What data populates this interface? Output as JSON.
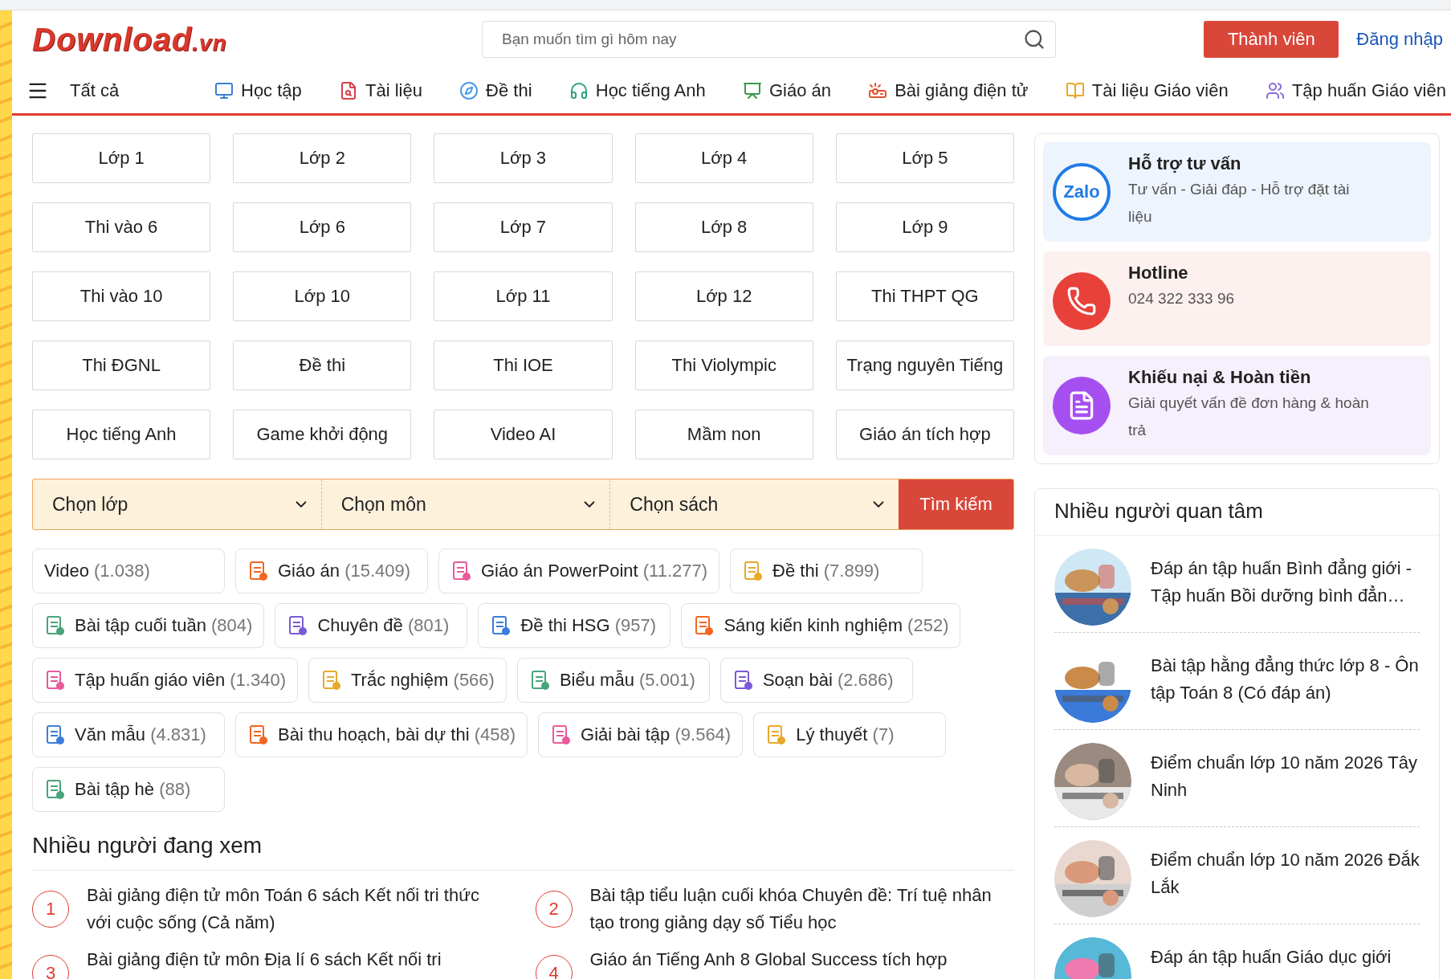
{
  "logo": {
    "name": "Download",
    "suffix": ".vn"
  },
  "search": {
    "placeholder": "Bạn muốn tìm gì hôm nay"
  },
  "header_buttons": [
    {
      "label": "Thành viên",
      "kind": "primary"
    },
    {
      "label": "Đăng nhập",
      "kind": "link"
    }
  ],
  "nav": {
    "all": "Tất cả",
    "items": [
      "Học tập",
      "Tài liệu",
      "Đề thi",
      "Học tiếng Anh",
      "Giáo án",
      "Bài giảng điện tử",
      "Tài liệu Giáo viên",
      "Tập huấn Giáo viên"
    ]
  },
  "classes": [
    "Lớp 1",
    "Lớp 2",
    "Lớp 3",
    "Lớp 4",
    "Lớp 5",
    "Thi vào 6",
    "Lớp 6",
    "Lớp 7",
    "Lớp 8",
    "Lớp 9",
    "Thi vào 10",
    "Lớp 10",
    "Lớp 11",
    "Lớp 12",
    "Thi THPT QG",
    "Thi ĐGNL",
    "Đề thi",
    "Thi IOE",
    "Thi Violympic",
    "Trạng nguyên Tiếng",
    "Học tiếng Anh",
    "Game khởi động",
    "Video AI",
    "Mầm non",
    "Giáo án tích hợp"
  ],
  "filter": {
    "selects": [
      "Chọn lớp",
      "Chọn môn",
      "Chọn sách"
    ],
    "button": "Tìm kiếm"
  },
  "tags": [
    {
      "label": "Video",
      "count": "(1.038)",
      "icon": false
    },
    {
      "label": "Giáo án",
      "count": "(15.409)",
      "icon": true
    },
    {
      "label": "Giáo án PowerPoint",
      "count": "(11.277)",
      "icon": true
    },
    {
      "label": "Đề thi",
      "count": "(7.899)",
      "icon": true
    },
    {
      "label": "Bài tập cuối tuần",
      "count": "(804)",
      "icon": true
    },
    {
      "label": "Chuyên đề",
      "count": "(801)",
      "icon": true
    },
    {
      "label": "Đề thi HSG",
      "count": "(957)",
      "icon": true
    },
    {
      "label": "Sáng kiến kinh nghiệm",
      "count": "(252)",
      "icon": true
    },
    {
      "label": "Tập huấn giáo viên",
      "count": "(1.340)",
      "icon": true
    },
    {
      "label": "Trắc nghiệm",
      "count": "(566)",
      "icon": true
    },
    {
      "label": "Biểu mẫu",
      "count": "(5.001)",
      "icon": true
    },
    {
      "label": "Soạn bài",
      "count": "(2.686)",
      "icon": true
    },
    {
      "label": "Văn mẫu",
      "count": "(4.831)",
      "icon": true
    },
    {
      "label": "Bài thu hoạch, bài dự thi",
      "count": "(458)",
      "icon": true
    },
    {
      "label": "Giải bài tập",
      "count": "(9.564)",
      "icon": true
    },
    {
      "label": "Lý thuyết",
      "count": "(7)",
      "icon": true
    },
    {
      "label": "Bài tập hè",
      "count": "(88)",
      "icon": true
    }
  ],
  "watching": {
    "title": "Nhiều người đang xem",
    "items": [
      {
        "number": "1",
        "title": "Bài giảng điện tử môn Toán 6 sách Kết nối tri thức với cuộc sống (Cả năm)"
      },
      {
        "number": "2",
        "title": "Bài tập tiểu luận cuối khóa Chuyên đề: Trí tuệ nhân tạo trong giảng dạy số Tiểu học"
      },
      {
        "number": "3",
        "title": "Bài giảng điện tử môn Địa lí 6 sách Kết nối tri"
      },
      {
        "number": "4",
        "title": "Giáo án Tiếng Anh 8 Global Success tích hợp"
      }
    ]
  },
  "support": [
    {
      "kind": "zalo",
      "color": "#eef4fd",
      "logo": "Zalo",
      "title": "Hỗ trợ tư vấn",
      "subtitle": "Tư vấn - Giải đáp - Hỗ trợ đặt tài liệu"
    },
    {
      "kind": "phone",
      "color": "#fdf1ef",
      "title": "Hotline",
      "subtitle": "024 322 333 96"
    },
    {
      "kind": "document",
      "color": "#f6f0fc",
      "title": "Khiếu nại & Hoàn tiền",
      "subtitle": "Giải quyết vấn đề đơn hàng & hoàn trả"
    }
  ],
  "popular": {
    "title": "Nhiều người quan tâm",
    "items": [
      {
        "title": "Đáp án tập huấn Bình đẳng giới - Tập huấn Bồi dưỡng bình đẳn…"
      },
      {
        "title": "Bài tập hằng đẳng thức lớp 8 - Ôn tập Toán 8 (Có đáp án)"
      },
      {
        "title": "Điểm chuẩn lớp 10 năm 2026 Tây Ninh"
      },
      {
        "title": "Điểm chuẩn lớp 10 năm 2026 Đắk Lắk"
      },
      {
        "title": "Đáp án tập huấn Giáo dục giới"
      }
    ]
  }
}
